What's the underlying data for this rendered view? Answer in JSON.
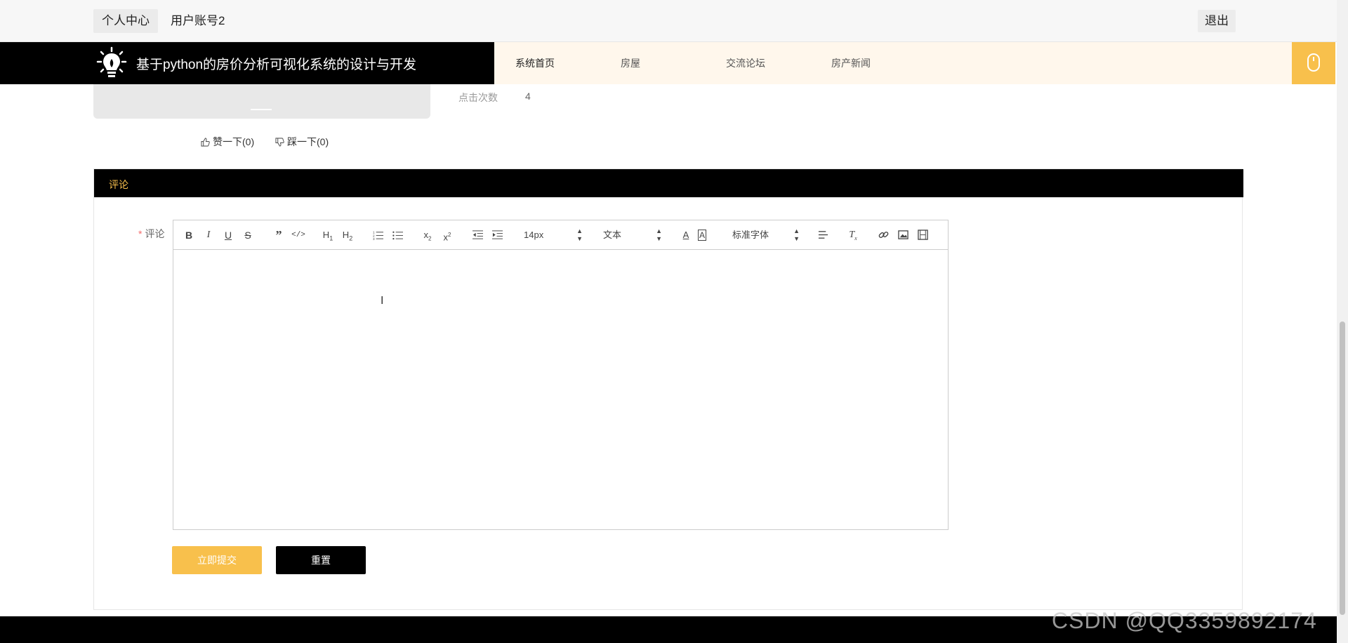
{
  "topbar": {
    "personal_center": "个人中心",
    "username": "用户账号2",
    "logout": "退出"
  },
  "header": {
    "title": "基于python的房价分析可视化系统的设计与开发",
    "nav": [
      "系统首页",
      "房屋",
      "交流论坛",
      "房产新闻"
    ]
  },
  "detail": {
    "clicks_label": "点击次数",
    "clicks_value": "4",
    "like": "赞一下(0)",
    "dislike": "踩一下(0)"
  },
  "comment": {
    "section_title": "评论",
    "field_label": "评论",
    "required_mark": "*",
    "font_size": "14px",
    "paragraph_format": "文本",
    "font_family": "标准字体",
    "submit_label": "立即提交",
    "reset_label": "重置"
  },
  "watermark": "CSDN @QQ3359892174",
  "colors": {
    "accent": "#f8c04c",
    "dark": "#000000",
    "nav_bg": "#fff7ec"
  }
}
